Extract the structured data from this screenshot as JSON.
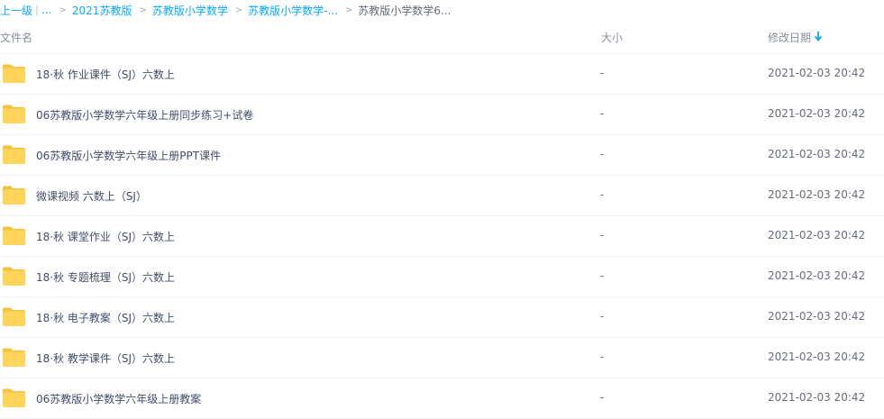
{
  "breadcrumb": {
    "up_label": "上一级",
    "ellipsis": "...",
    "items": [
      {
        "label": "2021苏教版"
      },
      {
        "label": "苏教版小学数学"
      },
      {
        "label": "苏教版小学数学-..."
      }
    ],
    "current": "苏教版小学数学6..."
  },
  "header": {
    "name": "文件名",
    "size": "大小",
    "date": "修改日期"
  },
  "files": [
    {
      "name": "18·秋 作业课件（SJ）六数上",
      "size": "-",
      "date": "2021-02-03 20:42"
    },
    {
      "name": "06苏教版小学数学六年级上册同步练习+试卷",
      "size": "-",
      "date": "2021-02-03 20:42"
    },
    {
      "name": "06苏教版小学数学六年级上册PPT课件",
      "size": "-",
      "date": "2021-02-03 20:42"
    },
    {
      "name": "微课视频 六数上（SJ）",
      "size": "-",
      "date": "2021-02-03 20:42"
    },
    {
      "name": "18·秋 课堂作业（SJ）六数上",
      "size": "-",
      "date": "2021-02-03 20:42"
    },
    {
      "name": "18·秋 专题梳理（SJ）六数上",
      "size": "-",
      "date": "2021-02-03 20:42"
    },
    {
      "name": "18·秋 电子教案（SJ）六数上",
      "size": "-",
      "date": "2021-02-03 20:42"
    },
    {
      "name": "18·秋 教学课件（SJ）六数上",
      "size": "-",
      "date": "2021-02-03 20:42"
    },
    {
      "name": "06苏教版小学数学六年级上册教案",
      "size": "-",
      "date": "2021-02-03 20:42"
    }
  ],
  "colors": {
    "link": "#09aaff",
    "folder": "#ffd55b",
    "folder_tab": "#f5c23b"
  },
  "icons": {
    "folder": "folder-icon",
    "sort": "sort-down-arrow-icon",
    "separator": "chevron-right-icon"
  }
}
